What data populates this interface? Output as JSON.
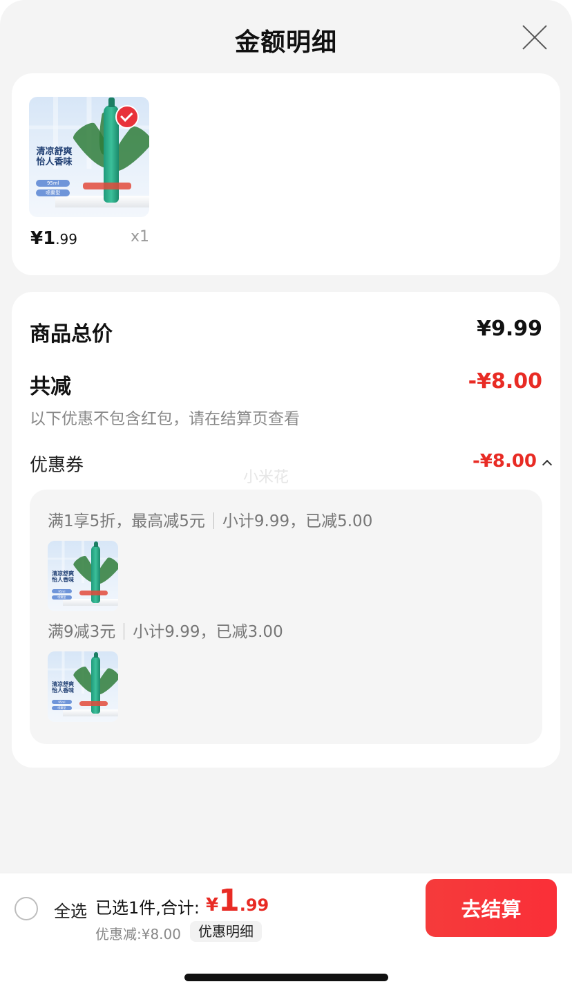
{
  "header": {
    "title": "金额明细"
  },
  "item": {
    "image": {
      "line1": "清凉舒爽",
      "line2": "怡人香味",
      "pill1": "95ml",
      "pill2": "喷雾型"
    },
    "price_symbol": "¥",
    "price_int": "1",
    "price_dec": ".99",
    "qty": "x1"
  },
  "summary": {
    "total_label": "商品总价",
    "total_value": "¥9.99",
    "reduce_label": "共减",
    "reduce_value": "-¥8.00",
    "note": "以下优惠不包含红包，请在结算页查看",
    "coupon_label": "优惠券",
    "coupon_value": "-¥8.00",
    "watermark": "小米花",
    "promos": [
      {
        "rule": "满1享5折，最高减5元",
        "detail": "小计9.99，已减5.00"
      },
      {
        "rule": "满9减3元",
        "detail": "小计9.99，已减3.00"
      }
    ]
  },
  "bottom_bar": {
    "select_all": "全选",
    "selected_text": "已选1件,合计:",
    "total_symbol": "¥",
    "total_int": "1",
    "total_dec": ".99",
    "discount_text": "优惠减:¥8.00",
    "detail_chip": "优惠明细",
    "checkout_label": "去结算"
  },
  "colors": {
    "accent_red": "#e82b24",
    "button_red": "#f53b3b",
    "sheet_bg": "#f4f4f4"
  }
}
